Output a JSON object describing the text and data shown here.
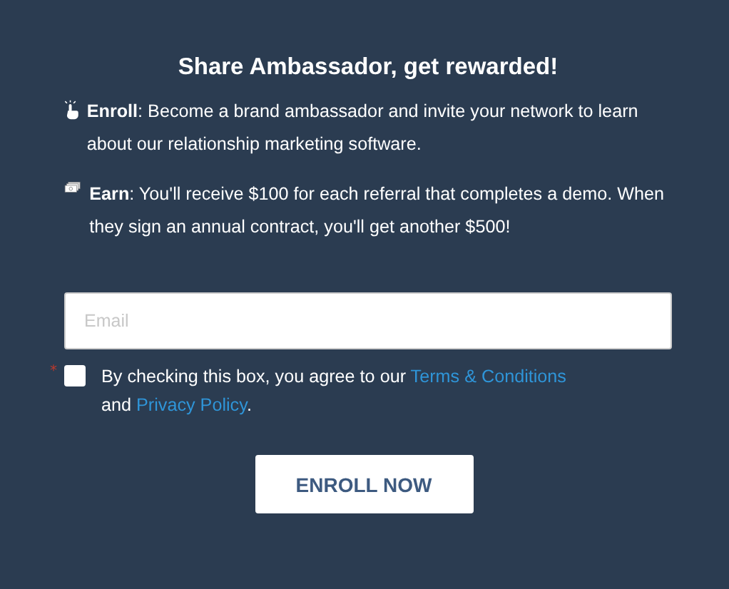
{
  "title": "Share Ambassador, get rewarded!",
  "items": [
    {
      "kind": "enroll",
      "text": "**Enroll**: Become a brand ambassador and invite your network to learn about our relationship marketing software."
    },
    {
      "kind": "earn",
      "text": "**Earn**: You'll receive $100 for each referral that completes a demo. When they sign an annual contract, you'll get another $500!"
    }
  ],
  "email": {
    "placeholder": "Email"
  },
  "agreement": {
    "required_mark": "*",
    "checked": false,
    "before": "By checking this box, you agree to our ",
    "terms_link": "Terms & Conditions",
    "middle": " and ",
    "privacy_link": "Privacy Policy",
    "after": "."
  },
  "button": "ENROLL NOW"
}
